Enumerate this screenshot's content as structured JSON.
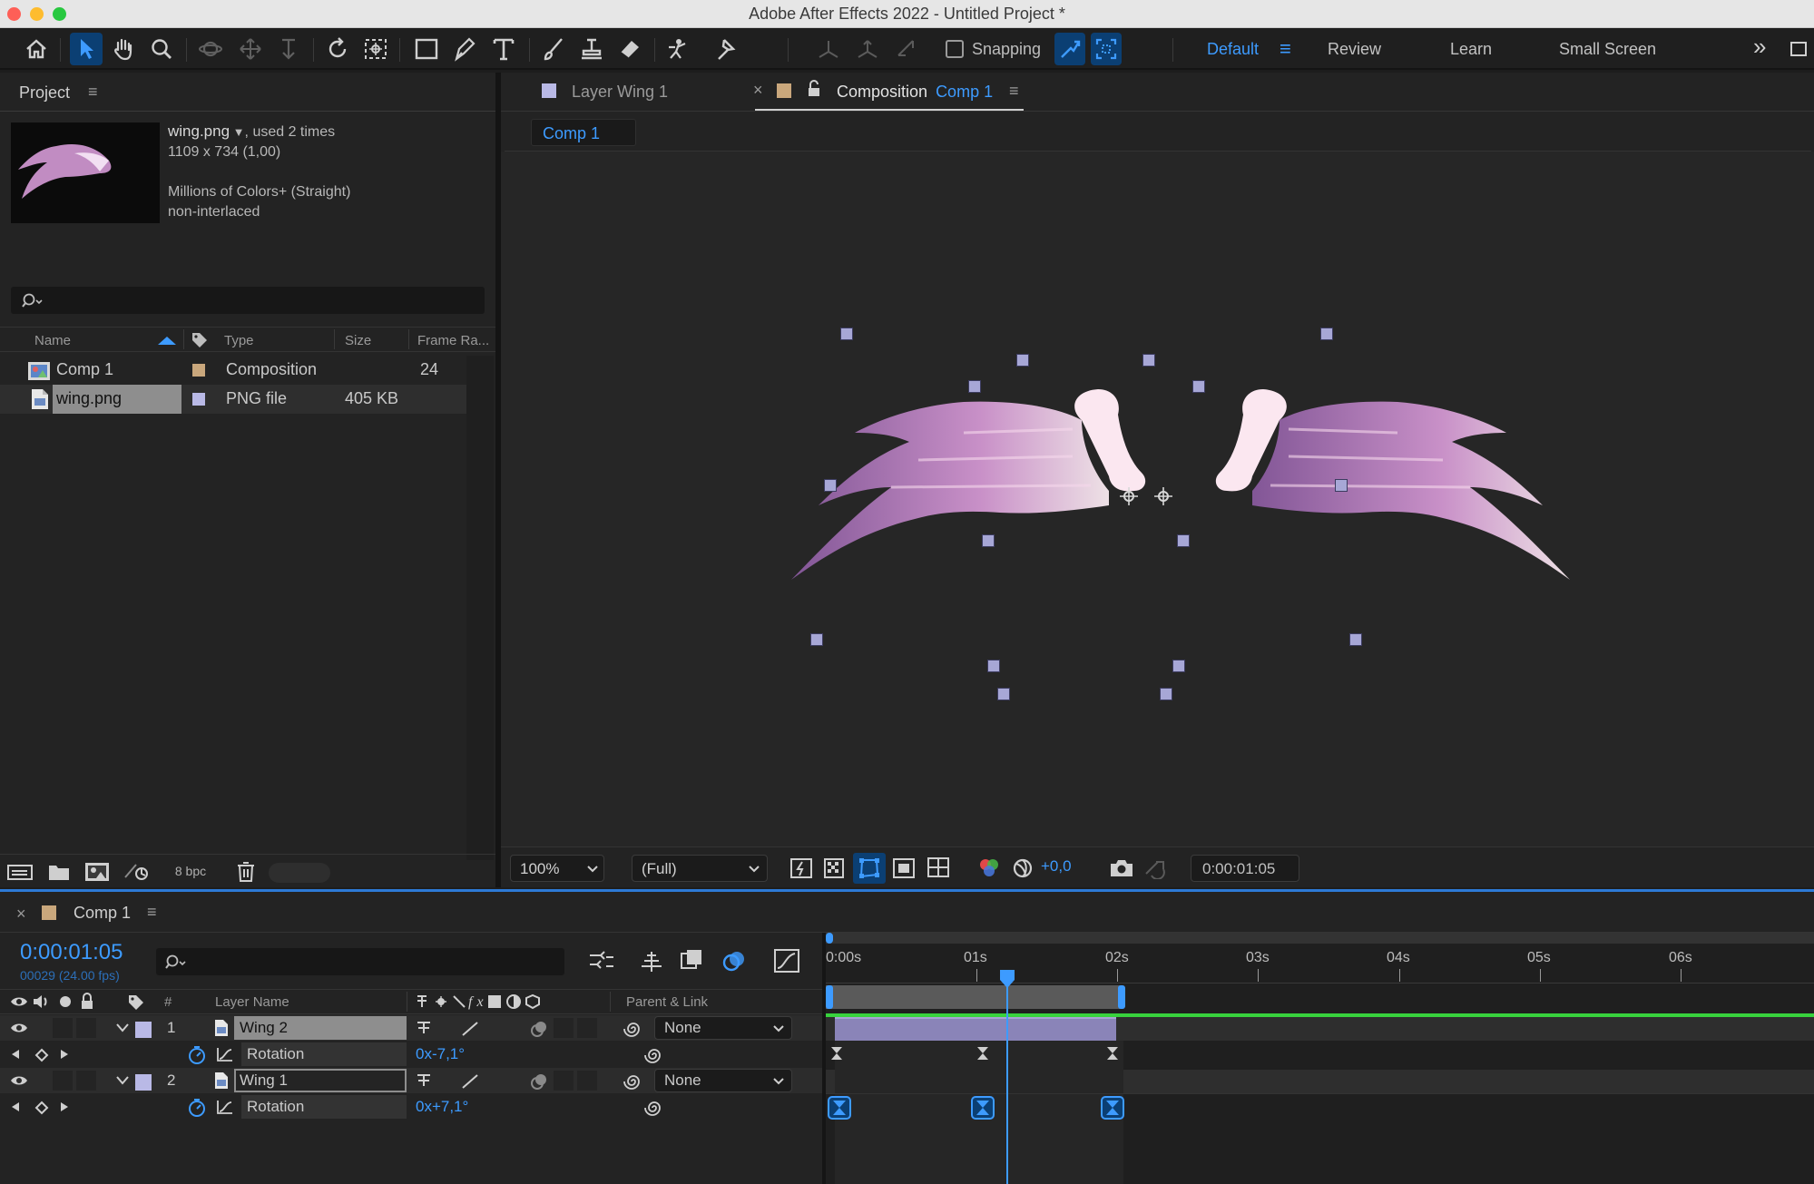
{
  "app": {
    "title": "Adobe After Effects 2022 - Untitled Project *"
  },
  "toolbar": {
    "snapping_label": "Snapping",
    "workspaces": [
      "Default",
      "Review",
      "Learn",
      "Small Screen"
    ],
    "more_label": "»"
  },
  "project": {
    "panel_title": "Project",
    "menu_icon": "≡",
    "file_name": "wing.png",
    "used_text": ", used 2 times",
    "dimensions": "1109 x 734 (1,00)",
    "colors": "Millions of Colors+ (Straight)",
    "interlace": "non-interlaced",
    "columns": {
      "name": "Name",
      "type": "Type",
      "size": "Size",
      "frame_rate": "Frame Ra..."
    },
    "items": [
      {
        "name": "Comp 1",
        "type": "Composition",
        "size": "",
        "fps": "24",
        "swatch": "#c9a77c",
        "icon": "composition-icon"
      },
      {
        "name": "wing.png",
        "type": "PNG file",
        "size": "405 KB",
        "fps": "",
        "swatch": "#b9b9e6",
        "icon": "png-file-icon"
      }
    ],
    "bpc_label": "8 bpc"
  },
  "viewer": {
    "tabs": [
      {
        "label": "Layer Wing 1",
        "prefix": "",
        "suffix": ""
      },
      {
        "label": "Composition",
        "suffix": "Comp 1"
      }
    ],
    "breadcrumb": "Comp 1",
    "zoom": "100%",
    "resolution": "(Full)",
    "exposure": "+0,0",
    "timecode": "0:00:01:05"
  },
  "timeline": {
    "tab_label": "Comp 1",
    "timecode": "0:00:01:05",
    "frame_info": "00029 (24.00 fps)",
    "col_hash": "#",
    "col_layer_name": "Layer Name",
    "col_parent": "Parent & Link",
    "ruler": [
      "0:00s",
      "01s",
      "02s",
      "03s",
      "04s",
      "05s",
      "06s"
    ],
    "layers": [
      {
        "num": "1",
        "name": "Wing 2",
        "parent": "None",
        "prop_name": "Rotation",
        "prop_value": "0x-7,1°"
      },
      {
        "num": "2",
        "name": "Wing 1",
        "parent": "None",
        "prop_name": "Rotation",
        "prop_value": "0x+7,1°"
      }
    ]
  },
  "colors": {
    "accent": "#2d8ceb",
    "work_area_green": "#38d23d",
    "layer_bar": "#8a84b8"
  }
}
